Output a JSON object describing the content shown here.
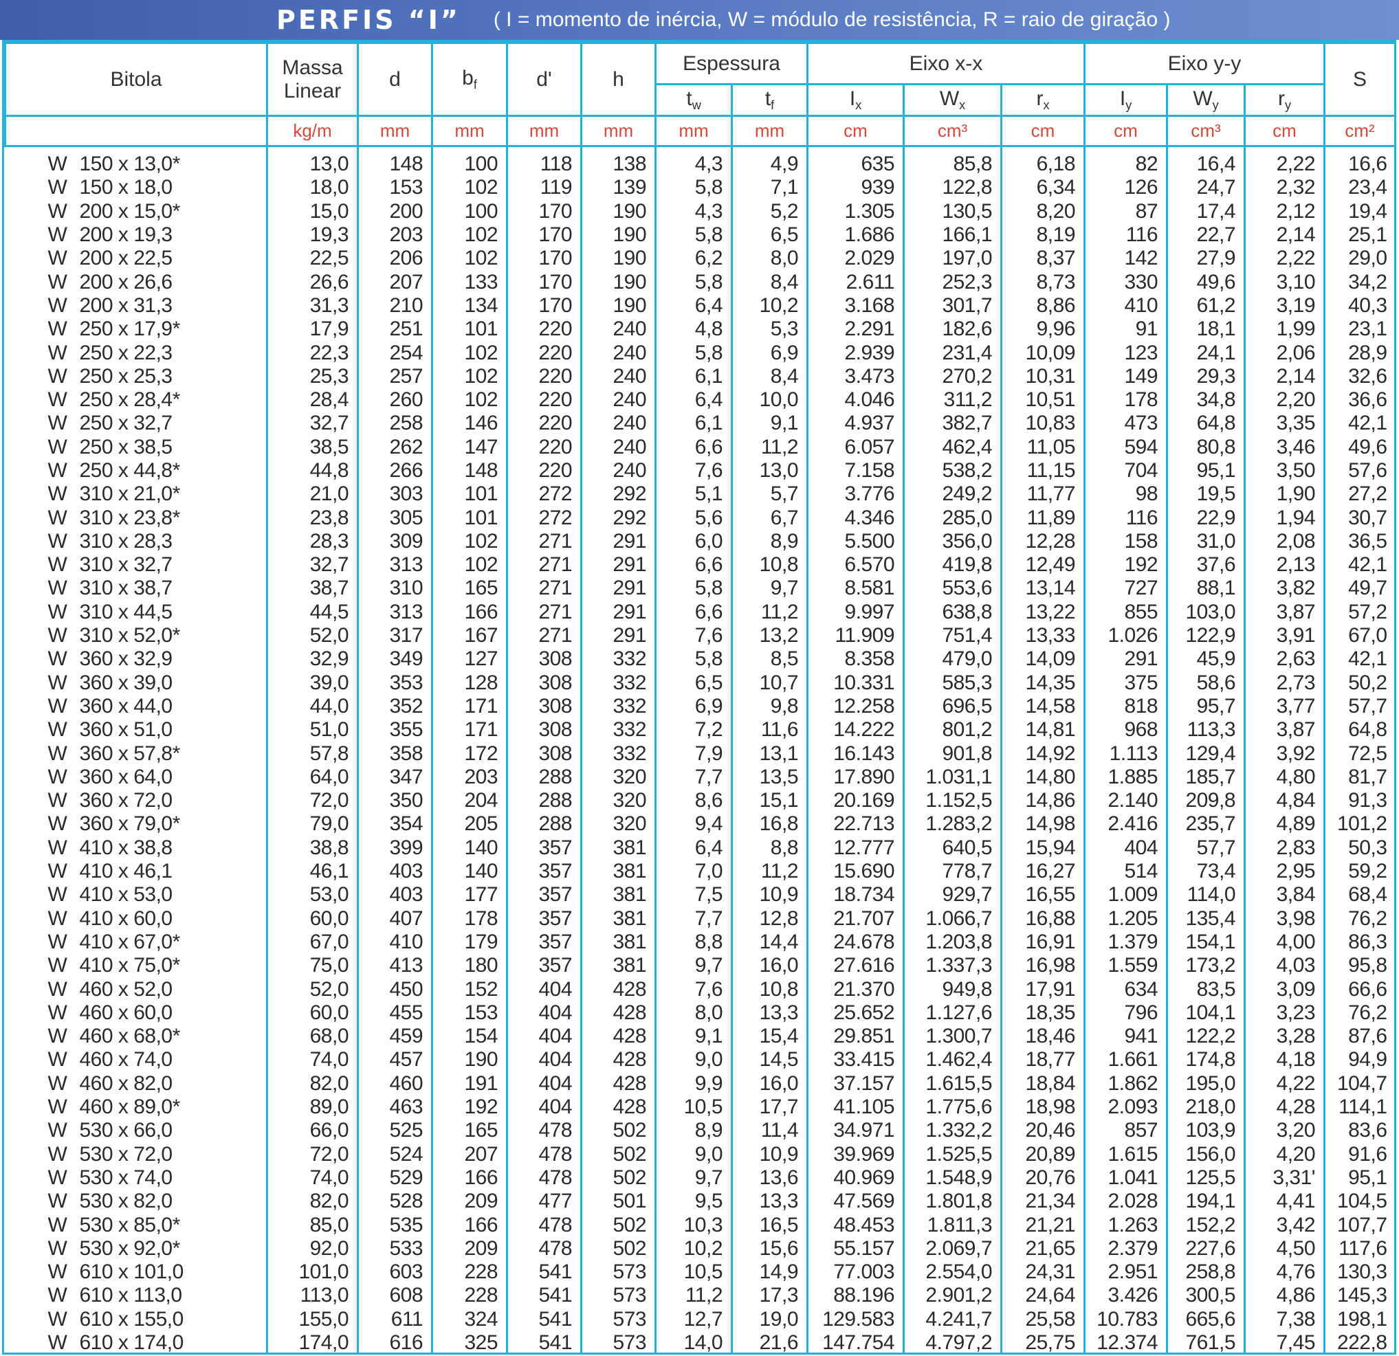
{
  "title": "PERFIS “I”",
  "subtitle": "( I = momento de inércia, W = módulo de resistência, R = raio de giração )",
  "headers": {
    "bitola": "Bitola",
    "massa": "Massa Linear",
    "d": "d",
    "bf": "b",
    "bf_sub": "f",
    "dprime": "d'",
    "h": "h",
    "espessura": "Espessura",
    "tw": "t",
    "tw_sub": "w",
    "tf": "t",
    "tf_sub": "f",
    "eixo_xx": "Eixo x-x",
    "ix": "I",
    "ix_sub": "x",
    "wx": "W",
    "wx_sub": "x",
    "rx": "r",
    "rx_sub": "x",
    "eixo_yy": "Eixo y-y",
    "iy": "I",
    "iy_sub": "y",
    "wy": "W",
    "wy_sub": "y",
    "ry": "r",
    "ry_sub": "y",
    "s": "S"
  },
  "units": [
    "kg/m",
    "mm",
    "mm",
    "mm",
    "mm",
    "mm",
    "mm",
    "cm",
    "cm³",
    "cm",
    "cm",
    "cm³",
    "cm",
    "cm²"
  ],
  "rows": [
    [
      "W",
      "150 x 13,0*",
      "13,0",
      "148",
      "100",
      "118",
      "138",
      "4,3",
      "4,9",
      "635",
      "85,8",
      "6,18",
      "82",
      "16,4",
      "2,22",
      "16,6"
    ],
    [
      "W",
      "150 x 18,0",
      "18,0",
      "153",
      "102",
      "119",
      "139",
      "5,8",
      "7,1",
      "939",
      "122,8",
      "6,34",
      "126",
      "24,7",
      "2,32",
      "23,4"
    ],
    [
      "W",
      "200 x 15,0*",
      "15,0",
      "200",
      "100",
      "170",
      "190",
      "4,3",
      "5,2",
      "1.305",
      "130,5",
      "8,20",
      "87",
      "17,4",
      "2,12",
      "19,4"
    ],
    [
      "W",
      "200 x 19,3",
      "19,3",
      "203",
      "102",
      "170",
      "190",
      "5,8",
      "6,5",
      "1.686",
      "166,1",
      "8,19",
      "116",
      "22,7",
      "2,14",
      "25,1"
    ],
    [
      "W",
      "200 x 22,5",
      "22,5",
      "206",
      "102",
      "170",
      "190",
      "6,2",
      "8,0",
      "2.029",
      "197,0",
      "8,37",
      "142",
      "27,9",
      "2,22",
      "29,0"
    ],
    [
      "W",
      "200 x 26,6",
      "26,6",
      "207",
      "133",
      "170",
      "190",
      "5,8",
      "8,4",
      "2.611",
      "252,3",
      "8,73",
      "330",
      "49,6",
      "3,10",
      "34,2"
    ],
    [
      "W",
      "200 x 31,3",
      "31,3",
      "210",
      "134",
      "170",
      "190",
      "6,4",
      "10,2",
      "3.168",
      "301,7",
      "8,86",
      "410",
      "61,2",
      "3,19",
      "40,3"
    ],
    [
      "W",
      "250 x 17,9*",
      "17,9",
      "251",
      "101",
      "220",
      "240",
      "4,8",
      "5,3",
      "2.291",
      "182,6",
      "9,96",
      "91",
      "18,1",
      "1,99",
      "23,1"
    ],
    [
      "W",
      "250 x 22,3",
      "22,3",
      "254",
      "102",
      "220",
      "240",
      "5,8",
      "6,9",
      "2.939",
      "231,4",
      "10,09",
      "123",
      "24,1",
      "2,06",
      "28,9"
    ],
    [
      "W",
      "250 x 25,3",
      "25,3",
      "257",
      "102",
      "220",
      "240",
      "6,1",
      "8,4",
      "3.473",
      "270,2",
      "10,31",
      "149",
      "29,3",
      "2,14",
      "32,6"
    ],
    [
      "W",
      "250 x 28,4*",
      "28,4",
      "260",
      "102",
      "220",
      "240",
      "6,4",
      "10,0",
      "4.046",
      "311,2",
      "10,51",
      "178",
      "34,8",
      "2,20",
      "36,6"
    ],
    [
      "W",
      "250 x 32,7",
      "32,7",
      "258",
      "146",
      "220",
      "240",
      "6,1",
      "9,1",
      "4.937",
      "382,7",
      "10,83",
      "473",
      "64,8",
      "3,35",
      "42,1"
    ],
    [
      "W",
      "250 x 38,5",
      "38,5",
      "262",
      "147",
      "220",
      "240",
      "6,6",
      "11,2",
      "6.057",
      "462,4",
      "11,05",
      "594",
      "80,8",
      "3,46",
      "49,6"
    ],
    [
      "W",
      "250 x 44,8*",
      "44,8",
      "266",
      "148",
      "220",
      "240",
      "7,6",
      "13,0",
      "7.158",
      "538,2",
      "11,15",
      "704",
      "95,1",
      "3,50",
      "57,6"
    ],
    [
      "W",
      "310 x 21,0*",
      "21,0",
      "303",
      "101",
      "272",
      "292",
      "5,1",
      "5,7",
      "3.776",
      "249,2",
      "11,77",
      "98",
      "19,5",
      "1,90",
      "27,2"
    ],
    [
      "W",
      "310 x 23,8*",
      "23,8",
      "305",
      "101",
      "272",
      "292",
      "5,6",
      "6,7",
      "4.346",
      "285,0",
      "11,89",
      "116",
      "22,9",
      "1,94",
      "30,7"
    ],
    [
      "W",
      "310 x 28,3",
      "28,3",
      "309",
      "102",
      "271",
      "291",
      "6,0",
      "8,9",
      "5.500",
      "356,0",
      "12,28",
      "158",
      "31,0",
      "2,08",
      "36,5"
    ],
    [
      "W",
      "310 x 32,7",
      "32,7",
      "313",
      "102",
      "271",
      "291",
      "6,6",
      "10,8",
      "6.570",
      "419,8",
      "12,49",
      "192",
      "37,6",
      "2,13",
      "42,1"
    ],
    [
      "W",
      "310 x 38,7",
      "38,7",
      "310",
      "165",
      "271",
      "291",
      "5,8",
      "9,7",
      "8.581",
      "553,6",
      "13,14",
      "727",
      "88,1",
      "3,82",
      "49,7"
    ],
    [
      "W",
      "310 x 44,5",
      "44,5",
      "313",
      "166",
      "271",
      "291",
      "6,6",
      "11,2",
      "9.997",
      "638,8",
      "13,22",
      "855",
      "103,0",
      "3,87",
      "57,2"
    ],
    [
      "W",
      "310 x 52,0*",
      "52,0",
      "317",
      "167",
      "271",
      "291",
      "7,6",
      "13,2",
      "11.909",
      "751,4",
      "13,33",
      "1.026",
      "122,9",
      "3,91",
      "67,0"
    ],
    [
      "W",
      "360 x 32,9",
      "32,9",
      "349",
      "127",
      "308",
      "332",
      "5,8",
      "8,5",
      "8.358",
      "479,0",
      "14,09",
      "291",
      "45,9",
      "2,63",
      "42,1"
    ],
    [
      "W",
      "360 x 39,0",
      "39,0",
      "353",
      "128",
      "308",
      "332",
      "6,5",
      "10,7",
      "10.331",
      "585,3",
      "14,35",
      "375",
      "58,6",
      "2,73",
      "50,2"
    ],
    [
      "W",
      "360 x 44,0",
      "44,0",
      "352",
      "171",
      "308",
      "332",
      "6,9",
      "9,8",
      "12.258",
      "696,5",
      "14,58",
      "818",
      "95,7",
      "3,77",
      "57,7"
    ],
    [
      "W",
      "360 x 51,0",
      "51,0",
      "355",
      "171",
      "308",
      "332",
      "7,2",
      "11,6",
      "14.222",
      "801,2",
      "14,81",
      "968",
      "113,3",
      "3,87",
      "64,8"
    ],
    [
      "W",
      "360 x 57,8*",
      "57,8",
      "358",
      "172",
      "308",
      "332",
      "7,9",
      "13,1",
      "16.143",
      "901,8",
      "14,92",
      "1.113",
      "129,4",
      "3,92",
      "72,5"
    ],
    [
      "W",
      "360 x 64,0",
      "64,0",
      "347",
      "203",
      "288",
      "320",
      "7,7",
      "13,5",
      "17.890",
      "1.031,1",
      "14,80",
      "1.885",
      "185,7",
      "4,80",
      "81,7"
    ],
    [
      "W",
      "360 x 72,0",
      "72,0",
      "350",
      "204",
      "288",
      "320",
      "8,6",
      "15,1",
      "20.169",
      "1.152,5",
      "14,86",
      "2.140",
      "209,8",
      "4,84",
      "91,3"
    ],
    [
      "W",
      "360 x 79,0*",
      "79,0",
      "354",
      "205",
      "288",
      "320",
      "9,4",
      "16,8",
      "22.713",
      "1.283,2",
      "14,98",
      "2.416",
      "235,7",
      "4,89",
      "101,2"
    ],
    [
      "W",
      "410 x 38,8",
      "38,8",
      "399",
      "140",
      "357",
      "381",
      "6,4",
      "8,8",
      "12.777",
      "640,5",
      "15,94",
      "404",
      "57,7",
      "2,83",
      "50,3"
    ],
    [
      "W",
      "410 x 46,1",
      "46,1",
      "403",
      "140",
      "357",
      "381",
      "7,0",
      "11,2",
      "15.690",
      "778,7",
      "16,27",
      "514",
      "73,4",
      "2,95",
      "59,2"
    ],
    [
      "W",
      "410 x 53,0",
      "53,0",
      "403",
      "177",
      "357",
      "381",
      "7,5",
      "10,9",
      "18.734",
      "929,7",
      "16,55",
      "1.009",
      "114,0",
      "3,84",
      "68,4"
    ],
    [
      "W",
      "410 x 60,0",
      "60,0",
      "407",
      "178",
      "357",
      "381",
      "7,7",
      "12,8",
      "21.707",
      "1.066,7",
      "16,88",
      "1.205",
      "135,4",
      "3,98",
      "76,2"
    ],
    [
      "W",
      "410 x 67,0*",
      "67,0",
      "410",
      "179",
      "357",
      "381",
      "8,8",
      "14,4",
      "24.678",
      "1.203,8",
      "16,91",
      "1.379",
      "154,1",
      "4,00",
      "86,3"
    ],
    [
      "W",
      "410 x 75,0*",
      "75,0",
      "413",
      "180",
      "357",
      "381",
      "9,7",
      "16,0",
      "27.616",
      "1.337,3",
      "16,98",
      "1.559",
      "173,2",
      "4,03",
      "95,8"
    ],
    [
      "W",
      "460 x 52,0",
      "52,0",
      "450",
      "152",
      "404",
      "428",
      "7,6",
      "10,8",
      "21.370",
      "949,8",
      "17,91",
      "634",
      "83,5",
      "3,09",
      "66,6"
    ],
    [
      "W",
      "460 x 60,0",
      "60,0",
      "455",
      "153",
      "404",
      "428",
      "8,0",
      "13,3",
      "25.652",
      "1.127,6",
      "18,35",
      "796",
      "104,1",
      "3,23",
      "76,2"
    ],
    [
      "W",
      "460 x 68,0*",
      "68,0",
      "459",
      "154",
      "404",
      "428",
      "9,1",
      "15,4",
      "29.851",
      "1.300,7",
      "18,46",
      "941",
      "122,2",
      "3,28",
      "87,6"
    ],
    [
      "W",
      "460 x 74,0",
      "74,0",
      "457",
      "190",
      "404",
      "428",
      "9,0",
      "14,5",
      "33.415",
      "1.462,4",
      "18,77",
      "1.661",
      "174,8",
      "4,18",
      "94,9"
    ],
    [
      "W",
      "460 x 82,0",
      "82,0",
      "460",
      "191",
      "404",
      "428",
      "9,9",
      "16,0",
      "37.157",
      "1.615,5",
      "18,84",
      "1.862",
      "195,0",
      "4,22",
      "104,7"
    ],
    [
      "W",
      "460 x 89,0*",
      "89,0",
      "463",
      "192",
      "404",
      "428",
      "10,5",
      "17,7",
      "41.105",
      "1.775,6",
      "18,98",
      "2.093",
      "218,0",
      "4,28",
      "114,1"
    ],
    [
      "W",
      "530 x 66,0",
      "66,0",
      "525",
      "165",
      "478",
      "502",
      "8,9",
      "11,4",
      "34.971",
      "1.332,2",
      "20,46",
      "857",
      "103,9",
      "3,20",
      "83,6"
    ],
    [
      "W",
      "530 x 72,0",
      "72,0",
      "524",
      "207",
      "478",
      "502",
      "9,0",
      "10,9",
      "39.969",
      "1.525,5",
      "20,89",
      "1.615",
      "156,0",
      "4,20",
      "91,6"
    ],
    [
      "W",
      "530 x 74,0",
      "74,0",
      "529",
      "166",
      "478",
      "502",
      "9,7",
      "13,6",
      "40.969",
      "1.548,9",
      "20,76",
      "1.041",
      "125,5",
      "3,31'",
      "95,1"
    ],
    [
      "W",
      "530 x 82,0",
      "82,0",
      "528",
      "209",
      "477",
      "501",
      "9,5",
      "13,3",
      "47.569",
      "1.801,8",
      "21,34",
      "2.028",
      "194,1",
      "4,41",
      "104,5"
    ],
    [
      "W",
      "530 x 85,0*",
      "85,0",
      "535",
      "166",
      "478",
      "502",
      "10,3",
      "16,5",
      "48.453",
      "1.811,3",
      "21,21",
      "1.263",
      "152,2",
      "3,42",
      "107,7"
    ],
    [
      "W",
      "530 x 92,0*",
      "92,0",
      "533",
      "209",
      "478",
      "502",
      "10,2",
      "15,6",
      "55.157",
      "2.069,7",
      "21,65",
      "2.379",
      "227,6",
      "4,50",
      "117,6"
    ],
    [
      "W",
      "610 x 101,0",
      "101,0",
      "603",
      "228",
      "541",
      "573",
      "10,5",
      "14,9",
      "77.003",
      "2.554,0",
      "24,31",
      "2.951",
      "258,8",
      "4,76",
      "130,3"
    ],
    [
      "W",
      "610 x 113,0",
      "113,0",
      "608",
      "228",
      "541",
      "573",
      "11,2",
      "17,3",
      "88.196",
      "2.901,2",
      "24,64",
      "3.426",
      "300,5",
      "4,86",
      "145,3"
    ],
    [
      "W",
      "610 x 155,0",
      "155,0",
      "611",
      "324",
      "541",
      "573",
      "12,7",
      "19,0",
      "129.583",
      "4.241,7",
      "25,58",
      "10.783",
      "665,6",
      "7,38",
      "198,1"
    ],
    [
      "W",
      "610 x 174,0",
      "174,0",
      "616",
      "325",
      "541",
      "573",
      "14,0",
      "21,6",
      "147.754",
      "4.797,2",
      "25,75",
      "12.374",
      "761,5",
      "7,45",
      "222,8"
    ]
  ]
}
